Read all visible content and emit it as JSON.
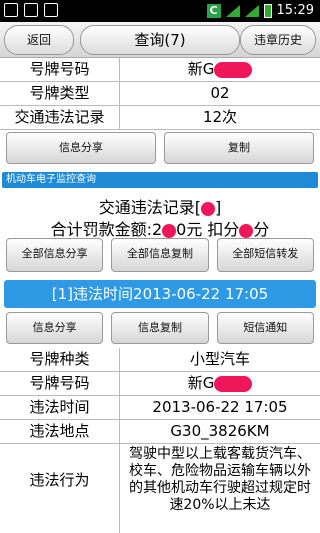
{
  "status": {
    "time": "15:29",
    "app_badge": "C"
  },
  "header": {
    "back": "返回",
    "title": "查询(7)",
    "history": "违章历史"
  },
  "top_rows": [
    {
      "key": "号牌号码",
      "value": "新G"
    },
    {
      "key": "号牌类型",
      "value": "02"
    },
    {
      "key": "交通违法记录",
      "value": "12次"
    }
  ],
  "top_buttons": [
    "信息分享",
    "复制"
  ],
  "section_title": "机动车电子监控查询",
  "summary": {
    "line1": "交通违法记录[",
    "line1_end": "]",
    "line2_a": "合计罚款金额:2",
    "line2_b": "0元 扣分",
    "line2_c": "分"
  },
  "all_buttons": [
    "全部信息分享",
    "全部信息复制",
    "全部短信转发"
  ],
  "record_bar": "[1]违法时间2013-06-22 17:05",
  "record_buttons": [
    "信息分享",
    "信息复制",
    "短信通知"
  ],
  "detail_rows": [
    {
      "key": "号牌种类",
      "value": "小型汽车"
    },
    {
      "key": "号牌号码",
      "value": "新G"
    },
    {
      "key": "违法时间",
      "value": "2013-06-22 17:05"
    },
    {
      "key": "违法地点",
      "value": "G30_3826KM"
    }
  ],
  "behavior": {
    "key": "违法行为",
    "value": "驾驶中型以上载客载货汽车、校车、危险物品运输车辆以外的其他机动车行驶超过规定时速20%以上未达"
  }
}
